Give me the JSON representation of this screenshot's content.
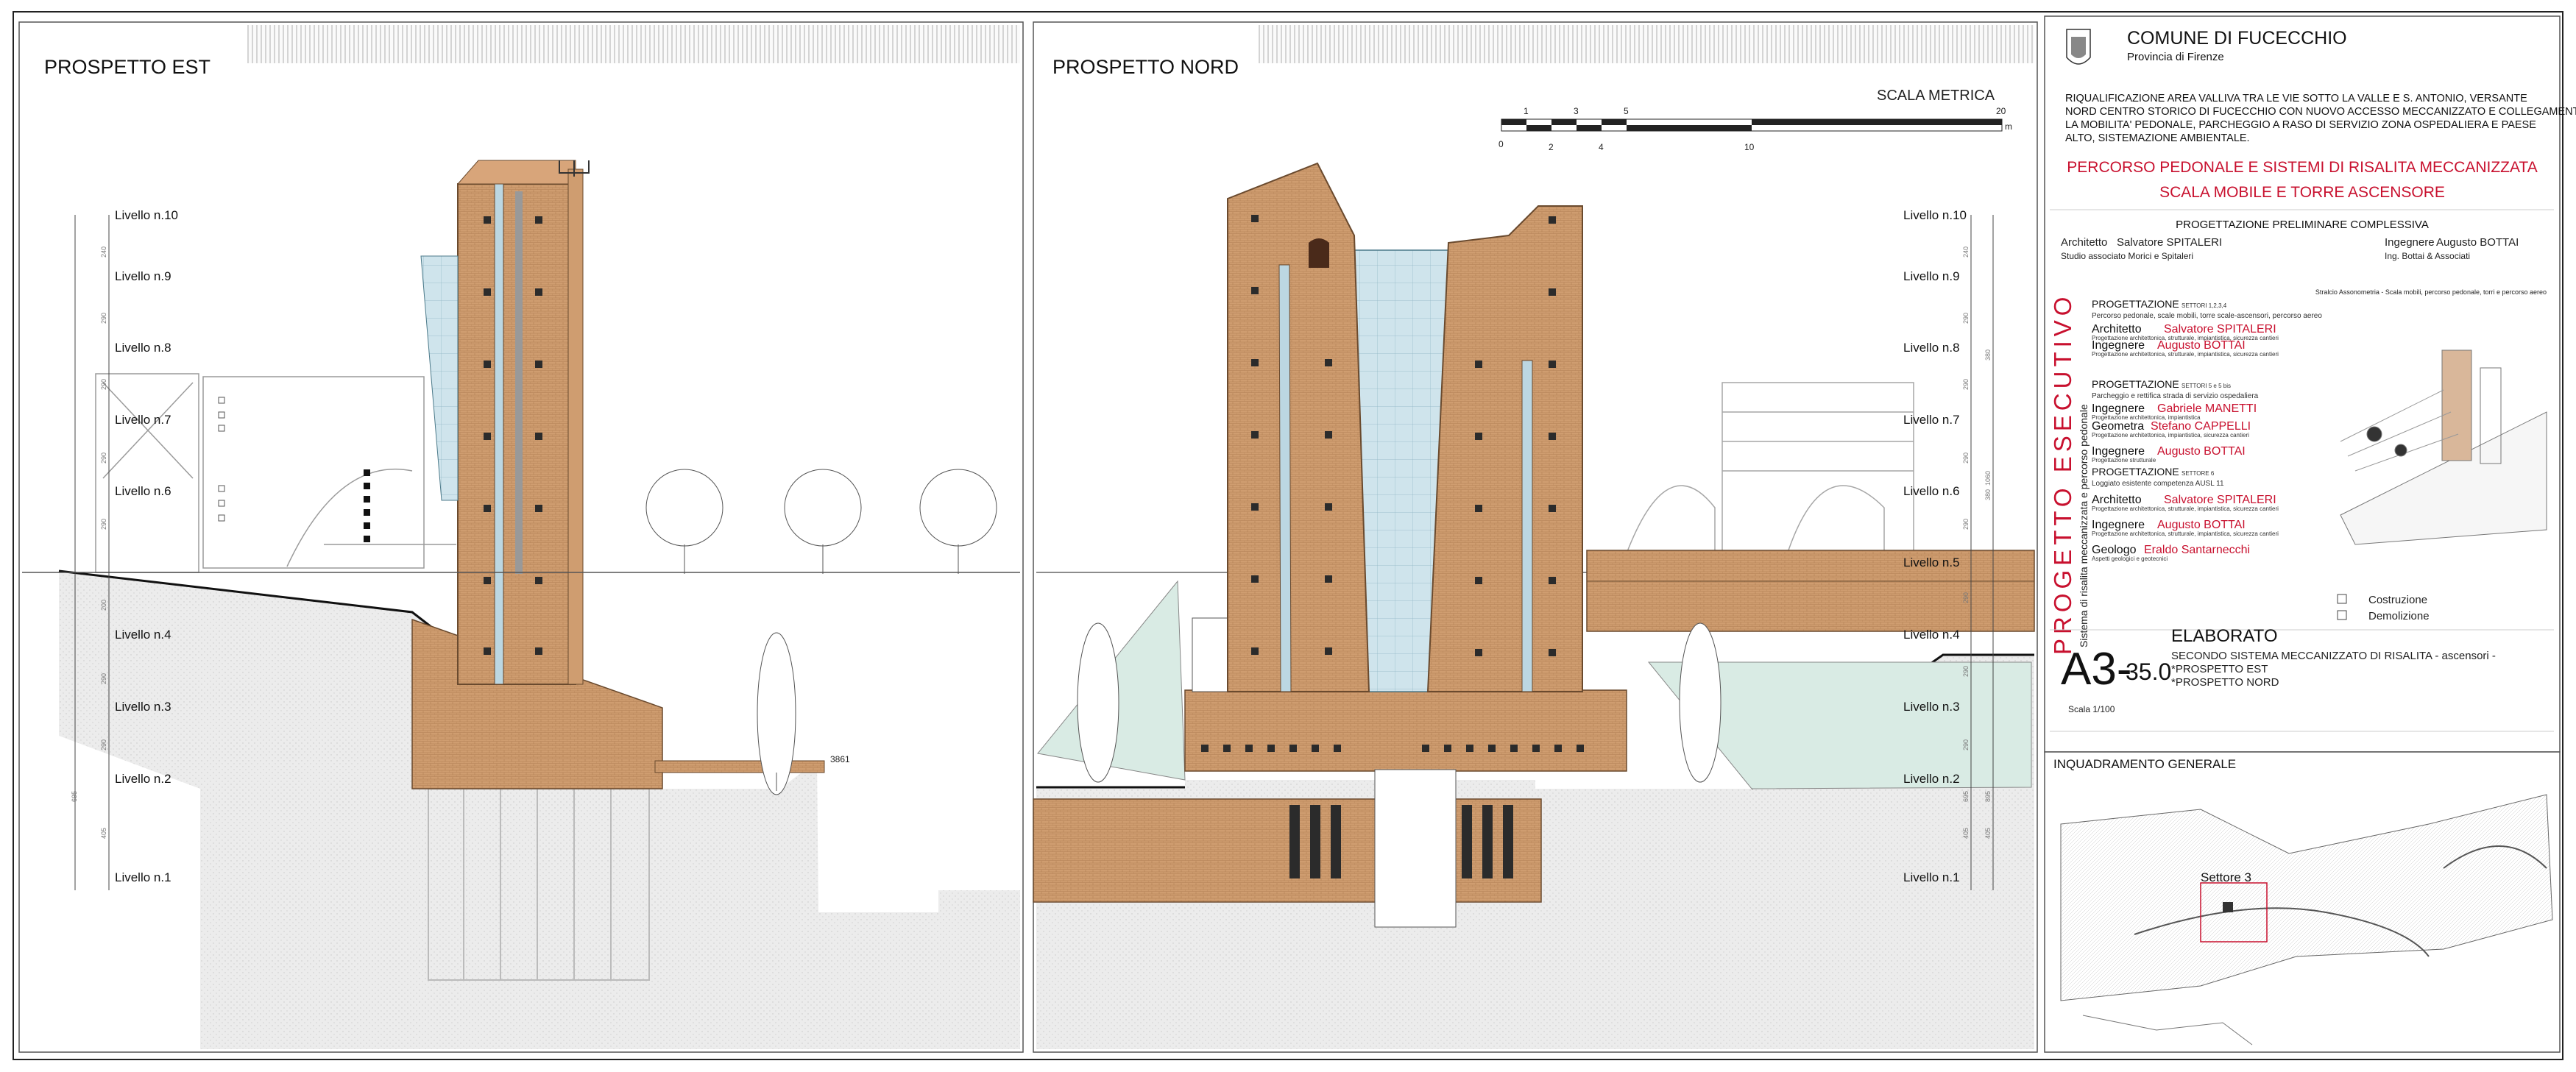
{
  "panels": {
    "east_title": "PROSPETTO EST",
    "north_title": "PROSPETTO NORD"
  },
  "scale_bar": {
    "title": "SCALA METRICA",
    "ticks_top": [
      "1",
      "3",
      "5",
      "20"
    ],
    "ticks_bottom": [
      "0",
      "2",
      "4",
      "10"
    ],
    "unit": "m"
  },
  "levels_east": [
    "Livello n.10",
    "Livello n.9",
    "Livello n.8",
    "Livello n.7",
    "Livello n.6",
    "Livello n.4",
    "Livello n.3",
    "Livello n.2",
    "Livello n.1"
  ],
  "levels_north": [
    "Livello n.10",
    "Livello n.9",
    "Livello n.8",
    "Livello n.7",
    "Livello n.6",
    "Livello n.5",
    "Livello n.4",
    "Livello n.3",
    "Livello n.2",
    "Livello n.1"
  ],
  "dimensions": {
    "east": [
      "240",
      "290",
      "290",
      "290",
      "290",
      "200",
      "290",
      "290",
      "405",
      "695"
    ],
    "north": [
      "240",
      "290",
      "290",
      "290",
      "290",
      "290",
      "290",
      "290",
      "405",
      "405",
      "380",
      "380",
      "1060",
      "895",
      "695"
    ],
    "spot_height": "3861"
  },
  "title_block": {
    "municipality": "COMUNE DI FUCECCHIO",
    "province": "Provincia di Firenze",
    "description": "RIQUALIFICAZIONE AREA VALLIVA TRA LE VIE SOTTO LA VALLE E S. ANTONIO, VERSANTE NORD CENTRO STORICO DI FUCECCHIO CON NUOVO ACCESSO MECCANIZZATO E COLLEGAMENTI PER LA MOBILITA' PEDONALE, PARCHEGGIO A RASO DI SERVIZIO ZONA OSPEDALIERA E PAESE ALTO, SISTEMAZIONE AMBIENTALE.",
    "project_title_1": "PERCORSO PEDONALE E SISTEMI DI RISALITA MECCANIZZATA",
    "project_title_2": "SCALA MOBILE E TORRE ASCENSORE",
    "prelim": "PROGETTAZIONE PRELIMINARE COMPLESSIVA",
    "arch_role": "Architetto",
    "arch_name": "Salvatore SPITALERI",
    "arch_studio": "Studio associato Morici e Spitaleri",
    "eng_role": "Ingegnere",
    "eng_name": "Augusto BOTTAI",
    "eng_studio": "Ing. Bottai & Associati",
    "axon_note": "Stralcio Assonometria - Scala mobili, percorso pedonale, torri e percorso aereo",
    "vertical_title": "PROGETTO ESECUTIVO",
    "vertical_sub": "Sistema di risalita meccanizzata e percorso pedonale",
    "sections": [
      {
        "heading": "PROGETTAZIONE",
        "sectors": "SETTORI 1,2,3,4",
        "desc": "Percorso pedonale, scale mobili, torre scale-ascensori, percorso aereo"
      },
      {
        "heading": "PROGETTAZIONE",
        "sectors": "SETTORI 5 e 5 bis",
        "desc": "Parcheggio e rettifica strada di servizio ospedaliera"
      },
      {
        "heading": "PROGETTAZIONE",
        "sectors": "SETTORE 6",
        "desc": "Loggiato esistente competenza AUSL 11"
      }
    ],
    "people": [
      {
        "role": "Architetto",
        "name": "Salvatore SPITALERI",
        "task": "Progettazione architettonica, strutturale, impiantistica, sicurezza cantieri"
      },
      {
        "role": "Ingegnere",
        "name": "Augusto BOTTAI",
        "task": "Progettazione architettonica, strutturale, impiantistica, sicurezza cantieri"
      },
      {
        "role": "Ingegnere",
        "name": "Gabriele MANETTI",
        "task": "Progettazione architettonica, impiantistica"
      },
      {
        "role": "Geometra",
        "name": "Stefano CAPPELLI",
        "task": "Progettazione architettonica, impiantistica, sicurezza cantieri"
      },
      {
        "role": "Ingegnere",
        "name": "Augusto BOTTAI",
        "task": "Progettazione strutturale"
      },
      {
        "role": "Architetto",
        "name": "Salvatore SPITALERI",
        "task": "Progettazione architettonica, strutturale, impiantistica, sicurezza cantieri"
      },
      {
        "role": "Ingegnere",
        "name": "Augusto BOTTAI",
        "task": "Progettazione architettonica, strutturale, impiantistica, sicurezza cantieri"
      },
      {
        "role": "Geologo",
        "name": "Eraldo Santarnecchi",
        "task": "Aspetti geologici e geotecnici"
      }
    ],
    "status_options": [
      "Costruzione",
      "Demolizione"
    ],
    "sheet_code": "A3-",
    "sheet_num": "35.0",
    "elaborato_label": "ELABORATO",
    "elaborato_desc": "SECONDO SISTEMA MECCANIZZATO DI RISALITA - ascensori -",
    "elaborato_items": [
      "*PROSPETTO EST",
      "*PROSPETTO NORD"
    ],
    "scale": "Scala  1/100",
    "inquadramento": "INQUADRAMENTO GENERALE",
    "sector_label": "Settore 3"
  },
  "colors": {
    "brick": "#c9956a",
    "glass": "#cfe4ec",
    "ground": "#e4e4e4",
    "accent_red": "#c8102e"
  }
}
